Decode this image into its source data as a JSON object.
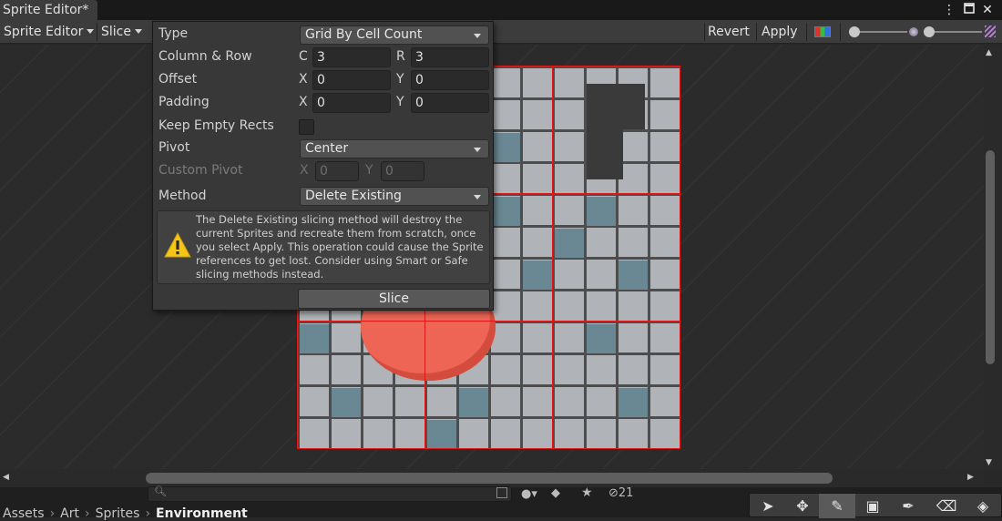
{
  "window": {
    "tab_title": "Sprite Editor*",
    "more_icon": "kebab-icon",
    "maximize_icon": "maximize-icon",
    "close_icon": "close-icon"
  },
  "toolbar": {
    "sprite_editor_menu": "Sprite Editor",
    "slice_menu": "Slice",
    "revert": "Revert",
    "apply": "Apply",
    "channel_icon": "rgb-channel-icon",
    "alpha_slider_value": 0.0,
    "zoom_slider_value": 0.0,
    "mip_icon": "mip-icon"
  },
  "slice_popup": {
    "type_label": "Type",
    "type_value": "Grid By Cell Count",
    "column_row_label": "Column & Row",
    "c_axis": "C",
    "c_value": "3",
    "r_axis": "R",
    "r_value": "3",
    "offset_label": "Offset",
    "offset_x_axis": "X",
    "offset_x": "0",
    "offset_y_axis": "Y",
    "offset_y": "0",
    "padding_label": "Padding",
    "padding_x_axis": "X",
    "padding_x": "0",
    "padding_y_axis": "Y",
    "padding_y": "0",
    "keep_empty_label": "Keep Empty Rects",
    "keep_empty_checked": false,
    "pivot_label": "Pivot",
    "pivot_value": "Center",
    "custom_pivot_label": "Custom Pivot",
    "custom_pivot_x_axis": "X",
    "custom_pivot_x": "0",
    "custom_pivot_y_axis": "Y",
    "custom_pivot_y": "0",
    "method_label": "Method",
    "method_value": "Delete Existing",
    "help_text": "The Delete Existing slicing method will destroy the current Sprites and recreate them from scratch, once you select Apply. This operation could cause the Sprite references to get lost. Consider using Smart or Safe slicing methods instead.",
    "slice_button": "Slice"
  },
  "canvas": {
    "slice_grid_columns": 3,
    "slice_grid_rows": 3,
    "slice_line_color": "#e01818"
  },
  "bottom": {
    "search_placeholder": "",
    "hidden_count": "21",
    "breadcrumb": [
      "Assets",
      "Art",
      "Sprites",
      "Environment"
    ]
  },
  "tools": [
    "select-icon",
    "move-icon",
    "brush-icon",
    "rect-icon",
    "eyedropper-icon",
    "eraser-icon",
    "fill-icon"
  ],
  "colors": {
    "accent_warning": "#f5c518"
  }
}
